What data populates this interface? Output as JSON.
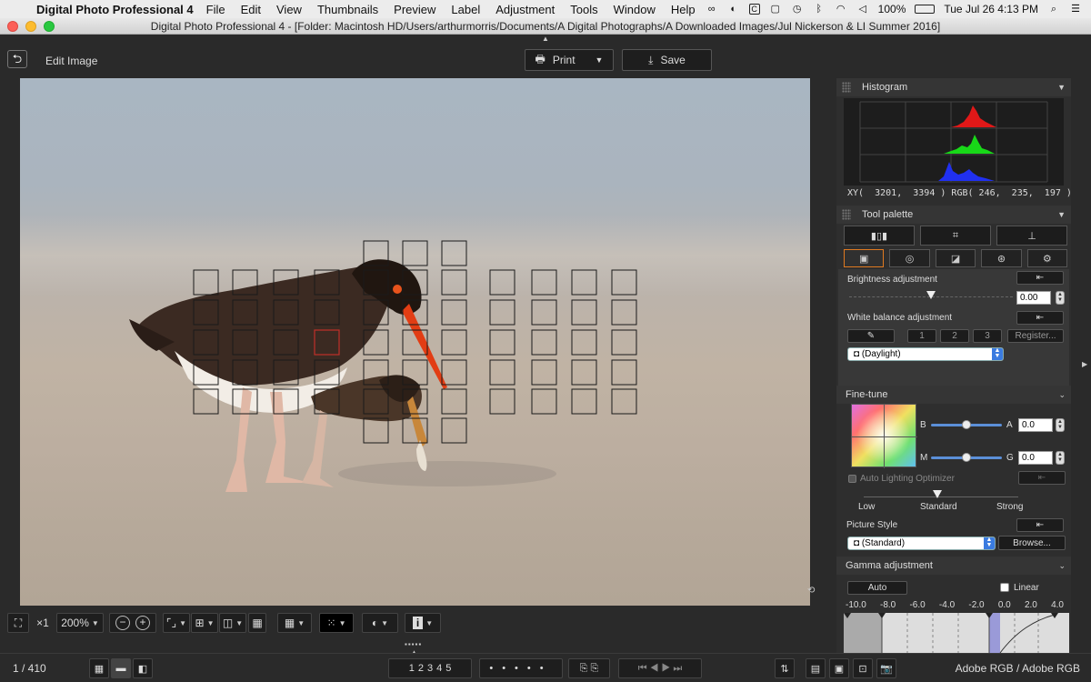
{
  "menubar": {
    "app_name": "Digital Photo Professional 4",
    "items": [
      "File",
      "Edit",
      "View",
      "Thumbnails",
      "Preview",
      "Label",
      "Adjustment",
      "Tools",
      "Window",
      "Help"
    ],
    "battery": "100%",
    "clock": "Tue Jul 26  4:13 PM"
  },
  "window": {
    "title": "Digital Photo Professional 4 - [Folder: Macintosh HD/Users/arthurmorris/Documents/A Digital Photographs/A Downloaded Images/Jul Nickerson & LI Summer 2016]"
  },
  "toolbar": {
    "edit_image_label": "Edit Image",
    "print_label": "Print",
    "save_label": "Save"
  },
  "viewer": {
    "zoom_x1": "×1",
    "zoom_level": "200%"
  },
  "status": {
    "counter": "1 / 410",
    "rating_labels": [
      "1",
      "2",
      "3",
      "4",
      "5"
    ],
    "color_space": "Adobe RGB / Adobe RGB"
  },
  "histogram": {
    "title": "Histogram",
    "xy_label": "XY(",
    "x": "3201,",
    "y": "3394 )",
    "rgb_label": "RGB(",
    "rgb": "246,  235,  197 )"
  },
  "tool_palette": {
    "title": "Tool palette",
    "brightness": {
      "label": "Brightness adjustment",
      "value": "0.00",
      "level": 0.5
    },
    "white_balance": {
      "label": "White balance adjustment",
      "presets": [
        "1",
        "2",
        "3"
      ],
      "register": "Register...",
      "selected": "(Daylight)"
    },
    "fine_tune": {
      "title": "Fine-tune",
      "b_label": "B",
      "a_label": "A",
      "a_value": "0.0",
      "m_label": "M",
      "g_label": "G",
      "g_value": "0.0"
    },
    "alo": {
      "label": "Auto Lighting Optimizer",
      "low": "Low",
      "standard": "Standard",
      "strong": "Strong"
    },
    "picture_style": {
      "label": "Picture Style",
      "selected": "(Standard)",
      "browse": "Browse..."
    },
    "gamma": {
      "title": "Gamma adjustment",
      "auto": "Auto",
      "linear": "Linear",
      "scale": [
        "-10.0",
        "-8.0",
        "-6.0",
        "-4.0",
        "-2.0",
        "0.0",
        "2.0",
        "4.0"
      ]
    }
  },
  "colors": {
    "menubar_bg": "#ececec",
    "app_bg": "#2a2a2a",
    "af_point": "#1a1a1a",
    "af_active": "#c0302a",
    "tab_accent": "#e07a20",
    "select_blue": "#3a7be0"
  },
  "icons": [
    "apple-icon",
    "back-icon",
    "printer-icon",
    "save-icon",
    "histogram-grip-icon",
    "gear-icon",
    "eyedropper-icon",
    "reset-icon",
    "camera-icon"
  ]
}
